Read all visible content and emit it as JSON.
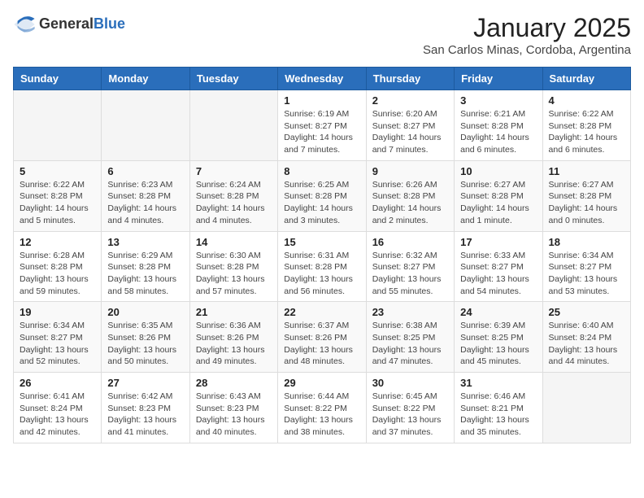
{
  "logo": {
    "general": "General",
    "blue": "Blue"
  },
  "header": {
    "month": "January 2025",
    "location": "San Carlos Minas, Cordoba, Argentina"
  },
  "weekdays": [
    "Sunday",
    "Monday",
    "Tuesday",
    "Wednesday",
    "Thursday",
    "Friday",
    "Saturday"
  ],
  "weeks": [
    [
      {
        "day": "",
        "info": ""
      },
      {
        "day": "",
        "info": ""
      },
      {
        "day": "",
        "info": ""
      },
      {
        "day": "1",
        "info": "Sunrise: 6:19 AM\nSunset: 8:27 PM\nDaylight: 14 hours and 7 minutes."
      },
      {
        "day": "2",
        "info": "Sunrise: 6:20 AM\nSunset: 8:27 PM\nDaylight: 14 hours and 7 minutes."
      },
      {
        "day": "3",
        "info": "Sunrise: 6:21 AM\nSunset: 8:28 PM\nDaylight: 14 hours and 6 minutes."
      },
      {
        "day": "4",
        "info": "Sunrise: 6:22 AM\nSunset: 8:28 PM\nDaylight: 14 hours and 6 minutes."
      }
    ],
    [
      {
        "day": "5",
        "info": "Sunrise: 6:22 AM\nSunset: 8:28 PM\nDaylight: 14 hours and 5 minutes."
      },
      {
        "day": "6",
        "info": "Sunrise: 6:23 AM\nSunset: 8:28 PM\nDaylight: 14 hours and 4 minutes."
      },
      {
        "day": "7",
        "info": "Sunrise: 6:24 AM\nSunset: 8:28 PM\nDaylight: 14 hours and 4 minutes."
      },
      {
        "day": "8",
        "info": "Sunrise: 6:25 AM\nSunset: 8:28 PM\nDaylight: 14 hours and 3 minutes."
      },
      {
        "day": "9",
        "info": "Sunrise: 6:26 AM\nSunset: 8:28 PM\nDaylight: 14 hours and 2 minutes."
      },
      {
        "day": "10",
        "info": "Sunrise: 6:27 AM\nSunset: 8:28 PM\nDaylight: 14 hours and 1 minute."
      },
      {
        "day": "11",
        "info": "Sunrise: 6:27 AM\nSunset: 8:28 PM\nDaylight: 14 hours and 0 minutes."
      }
    ],
    [
      {
        "day": "12",
        "info": "Sunrise: 6:28 AM\nSunset: 8:28 PM\nDaylight: 13 hours and 59 minutes."
      },
      {
        "day": "13",
        "info": "Sunrise: 6:29 AM\nSunset: 8:28 PM\nDaylight: 13 hours and 58 minutes."
      },
      {
        "day": "14",
        "info": "Sunrise: 6:30 AM\nSunset: 8:28 PM\nDaylight: 13 hours and 57 minutes."
      },
      {
        "day": "15",
        "info": "Sunrise: 6:31 AM\nSunset: 8:28 PM\nDaylight: 13 hours and 56 minutes."
      },
      {
        "day": "16",
        "info": "Sunrise: 6:32 AM\nSunset: 8:27 PM\nDaylight: 13 hours and 55 minutes."
      },
      {
        "day": "17",
        "info": "Sunrise: 6:33 AM\nSunset: 8:27 PM\nDaylight: 13 hours and 54 minutes."
      },
      {
        "day": "18",
        "info": "Sunrise: 6:34 AM\nSunset: 8:27 PM\nDaylight: 13 hours and 53 minutes."
      }
    ],
    [
      {
        "day": "19",
        "info": "Sunrise: 6:34 AM\nSunset: 8:27 PM\nDaylight: 13 hours and 52 minutes."
      },
      {
        "day": "20",
        "info": "Sunrise: 6:35 AM\nSunset: 8:26 PM\nDaylight: 13 hours and 50 minutes."
      },
      {
        "day": "21",
        "info": "Sunrise: 6:36 AM\nSunset: 8:26 PM\nDaylight: 13 hours and 49 minutes."
      },
      {
        "day": "22",
        "info": "Sunrise: 6:37 AM\nSunset: 8:26 PM\nDaylight: 13 hours and 48 minutes."
      },
      {
        "day": "23",
        "info": "Sunrise: 6:38 AM\nSunset: 8:25 PM\nDaylight: 13 hours and 47 minutes."
      },
      {
        "day": "24",
        "info": "Sunrise: 6:39 AM\nSunset: 8:25 PM\nDaylight: 13 hours and 45 minutes."
      },
      {
        "day": "25",
        "info": "Sunrise: 6:40 AM\nSunset: 8:24 PM\nDaylight: 13 hours and 44 minutes."
      }
    ],
    [
      {
        "day": "26",
        "info": "Sunrise: 6:41 AM\nSunset: 8:24 PM\nDaylight: 13 hours and 42 minutes."
      },
      {
        "day": "27",
        "info": "Sunrise: 6:42 AM\nSunset: 8:23 PM\nDaylight: 13 hours and 41 minutes."
      },
      {
        "day": "28",
        "info": "Sunrise: 6:43 AM\nSunset: 8:23 PM\nDaylight: 13 hours and 40 minutes."
      },
      {
        "day": "29",
        "info": "Sunrise: 6:44 AM\nSunset: 8:22 PM\nDaylight: 13 hours and 38 minutes."
      },
      {
        "day": "30",
        "info": "Sunrise: 6:45 AM\nSunset: 8:22 PM\nDaylight: 13 hours and 37 minutes."
      },
      {
        "day": "31",
        "info": "Sunrise: 6:46 AM\nSunset: 8:21 PM\nDaylight: 13 hours and 35 minutes."
      },
      {
        "day": "",
        "info": ""
      }
    ]
  ]
}
